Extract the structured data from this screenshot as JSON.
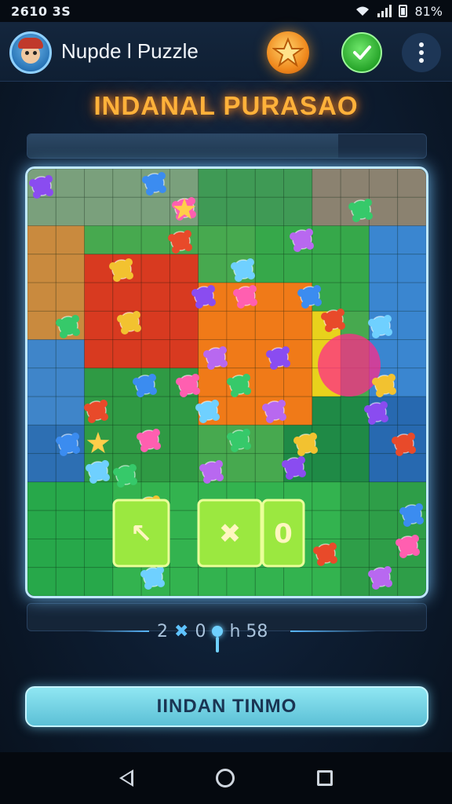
{
  "status_bar": {
    "time": "2610 3S",
    "battery": "81%",
    "icons": [
      "wifi-icon",
      "signal-icon",
      "battery-icon"
    ]
  },
  "header": {
    "app_title": "Nupde l Puzzle",
    "avatar_icon": "avatar-icon",
    "star_icon": "star-icon",
    "check_icon": "check-icon",
    "menu_icon": "more-vertical-icon"
  },
  "level_title": "INDANAL PURASAO",
  "progress": {
    "fraction": 0.78
  },
  "board": {
    "rows": 15,
    "cols": 14,
    "highlight_tiles": [
      "",
      "✖",
      "0"
    ],
    "highlight_icons": [
      "arrow-icon",
      "multiply-icon",
      "zero-icon"
    ]
  },
  "moves": {
    "count_left": "2",
    "symbol": "✖",
    "count_mid": "0",
    "suffix": "h 58"
  },
  "main_button_label": "IINDAN TINMO",
  "nav": {
    "back_icon": "back-icon",
    "home_icon": "home-icon",
    "recent_icon": "recent-apps-icon"
  },
  "colors": {
    "accent_orange": "#ffb13a",
    "board_glow": "#bfe8ff",
    "button": "#8fe6f2"
  }
}
